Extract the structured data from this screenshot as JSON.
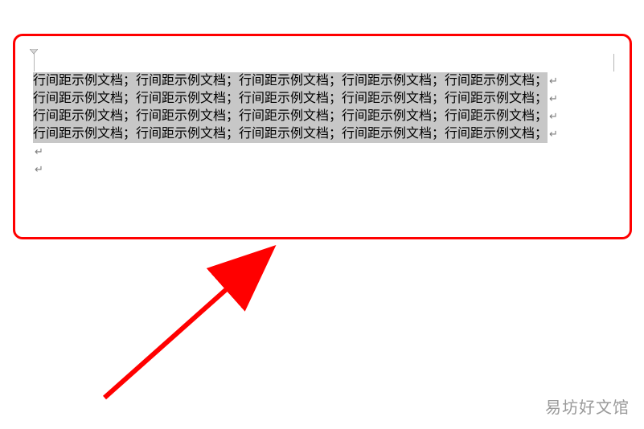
{
  "document": {
    "segment": "行间距示例文档；",
    "repeats_per_line": 5,
    "line_count": 4,
    "paragraph_mark": "↵",
    "empty_paragraph_count": 2,
    "selection_highlight": "#c7c7c7"
  },
  "annotation": {
    "frame_color": "#ff0000",
    "arrow_color": "#ff0000"
  },
  "watermark": "易坊好文馆"
}
